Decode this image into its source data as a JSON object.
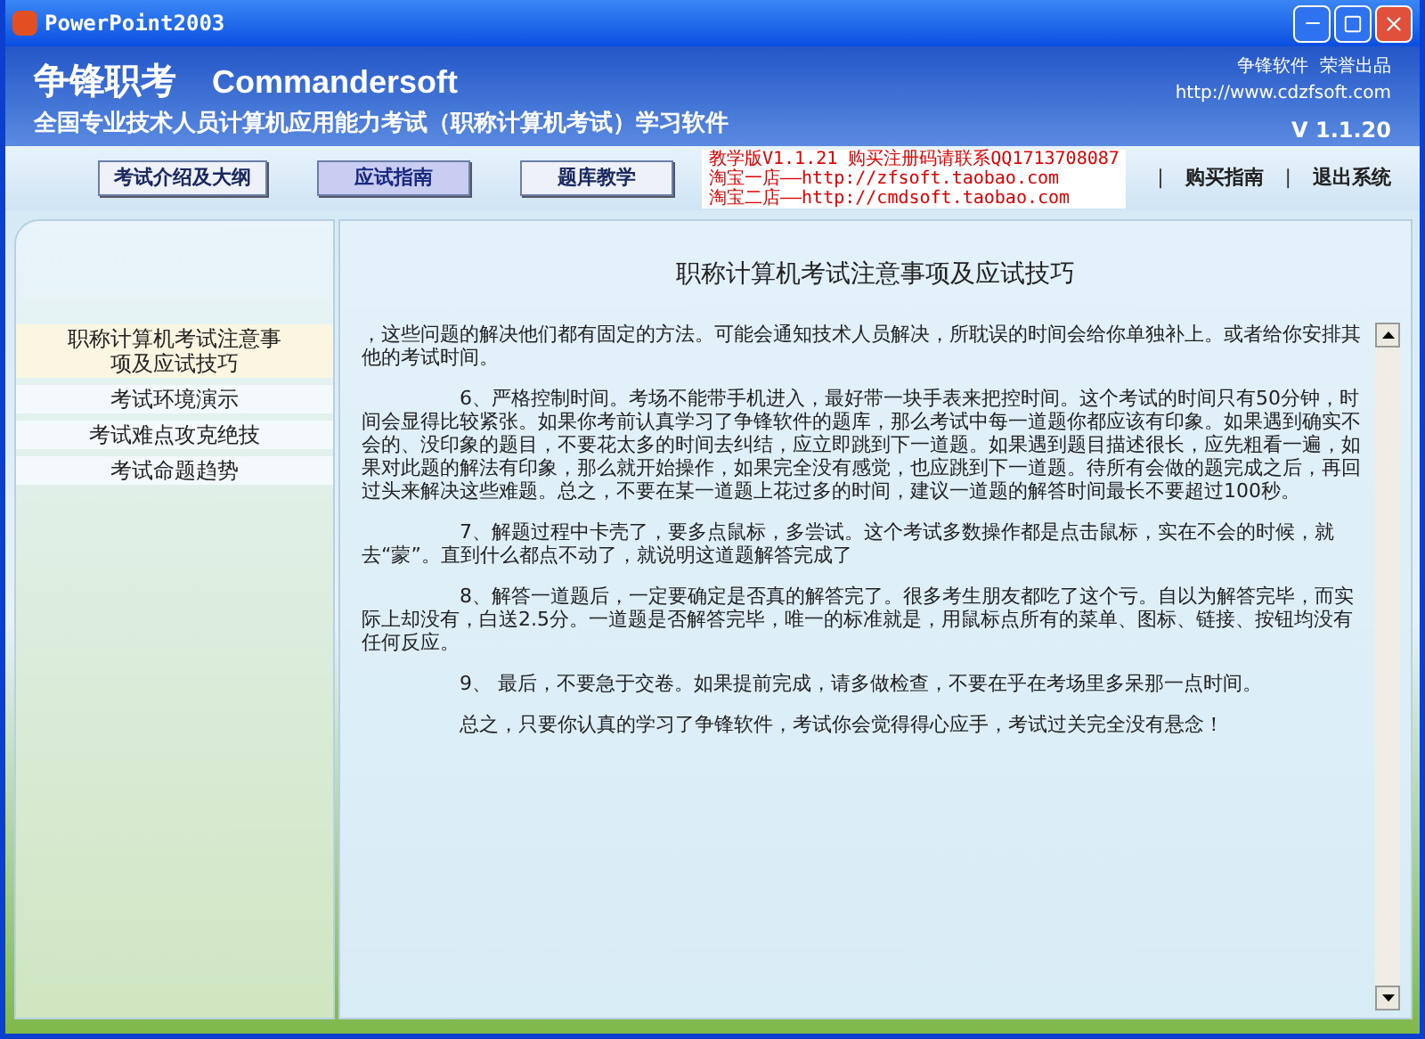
{
  "window": {
    "title": "PowerPoint2003"
  },
  "header": {
    "brand": "争锋职考",
    "brand_en": "Commandersoft",
    "subtitle": "全国专业技术人员计算机应用能力考试（职称计算机考试）学习软件",
    "publisher": "争锋软件  荣誉出品",
    "url": "http://www.cdzfsoft.com",
    "version": "V 1.1.20"
  },
  "nav_buttons": [
    {
      "label": "考试介绍及大纲",
      "selected": false
    },
    {
      "label": "应试指南",
      "selected": true
    },
    {
      "label": "题库教学",
      "selected": false
    }
  ],
  "notice": [
    "教学版V1.1.21  购买注册码请联系QQ1713708087",
    "淘宝一店——http://zfsoft.taobao.com",
    "淘宝二店——http://cmdsoft.taobao.com"
  ],
  "links": [
    {
      "separator": "|",
      "label": "购买指南"
    },
    {
      "separator": "|",
      "label": "退出系统"
    }
  ],
  "sidebar": {
    "items": [
      {
        "label": "职称计算机考试注意事项及应试技巧",
        "selected": true
      },
      {
        "label": "考试环境演示",
        "selected": false
      },
      {
        "label": "考试难点攻克绝技",
        "selected": false
      },
      {
        "label": "考试命题趋势",
        "selected": false
      }
    ]
  },
  "article": {
    "title": "职称计算机考试注意事项及应试技巧",
    "paragraphs": [
      {
        "text": "，这些问题的解决他们都有固定的方法。可能会通知技术人员解决，所耽误的时间会给你单独补上。或者给你安排其他的考试时间。",
        "indent": false
      },
      {
        "text": "6、严格控制时间。考场不能带手机进入，最好带一块手表来把控时间。这个考试的时间只有50分钟，时间会显得比较紧张。如果你考前认真学习了争锋软件的题库，那么考试中每一道题你都应该有印象。如果遇到确实不会的、没印象的题目，不要花太多的时间去纠结，应立即跳到下一道题。如果遇到题目描述很长，应先粗看一遍，如果对此题的解法有印象，那么就开始操作，如果完全没有感觉，也应跳到下一道题。待所有会做的题完成之后，再回过头来解决这些难题。总之，不要在某一道题上花过多的时间，建议一道题的解答时间最长不要超过100秒。",
        "indent": true
      },
      {
        "text": "7、解题过程中卡壳了，要多点鼠标，多尝试。这个考试多数操作都是点击鼠标，实在不会的时候，就去“蒙”。直到什么都点不动了，就说明这道题解答完成了",
        "indent": true
      },
      {
        "text": "8、解答一道题后，一定要确定是否真的解答完了。很多考生朋友都吃了这个亏。自以为解答完毕，而实际上却没有，白送2.5分。一道题是否解答完毕，唯一的标准就是，用鼠标点所有的菜单、图标、链接、按钮均没有任何反应。",
        "indent": true
      },
      {
        "text": "9、  最后，不要急于交卷。如果提前完成，请多做检查，不要在乎在考场里多呆那一点时间。",
        "indent": true
      },
      {
        "text": "总之，只要你认真的学习了争锋软件，考试你会觉得得心应手，考试过关完全没有悬念！",
        "indent": true
      }
    ]
  }
}
